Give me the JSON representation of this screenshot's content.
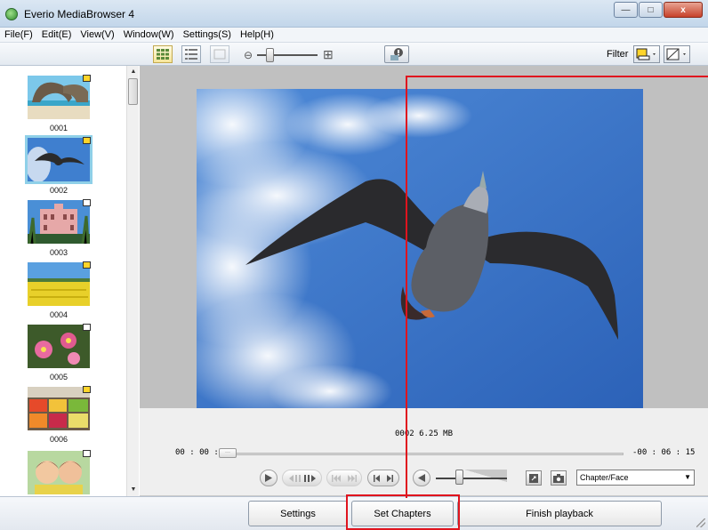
{
  "window": {
    "title": "Everio MediaBrowser 4",
    "minimize": "—",
    "maximize": "□",
    "close": "x"
  },
  "menu": {
    "items": [
      "File(F)",
      "Edit(E)",
      "View(V)",
      "Window(W)",
      "Settings(S)",
      "Help(H)"
    ]
  },
  "toolbar": {
    "filter_label": "Filter",
    "filter_color": "#ffd42a"
  },
  "sidebar": {
    "thumbnails": [
      {
        "label": "0001",
        "flag": "yellow",
        "scene": "coast"
      },
      {
        "label": "0002",
        "flag": "yellow",
        "scene": "bird",
        "selected": true
      },
      {
        "label": "0003",
        "flag": "white",
        "scene": "building"
      },
      {
        "label": "0004",
        "flag": "yellow",
        "scene": "field"
      },
      {
        "label": "0005",
        "flag": "white",
        "scene": "flowers"
      },
      {
        "label": "0006",
        "flag": "yellow",
        "scene": "market"
      },
      {
        "label": "",
        "flag": "white",
        "scene": "kids"
      }
    ]
  },
  "viewer": {
    "file_info": "0002 6.25 MB",
    "time_start": "00 : 00 : 00",
    "time_end": "-00 : 06 : 15"
  },
  "controls": {
    "mode_select": "Chapter/Face"
  },
  "bottom": {
    "settings": "Settings",
    "set_chapters": "Set Chapters",
    "finish_playback": "Finish playback"
  },
  "colors": {
    "highlight": "#e0141e",
    "sky": "#2f6fc4"
  }
}
